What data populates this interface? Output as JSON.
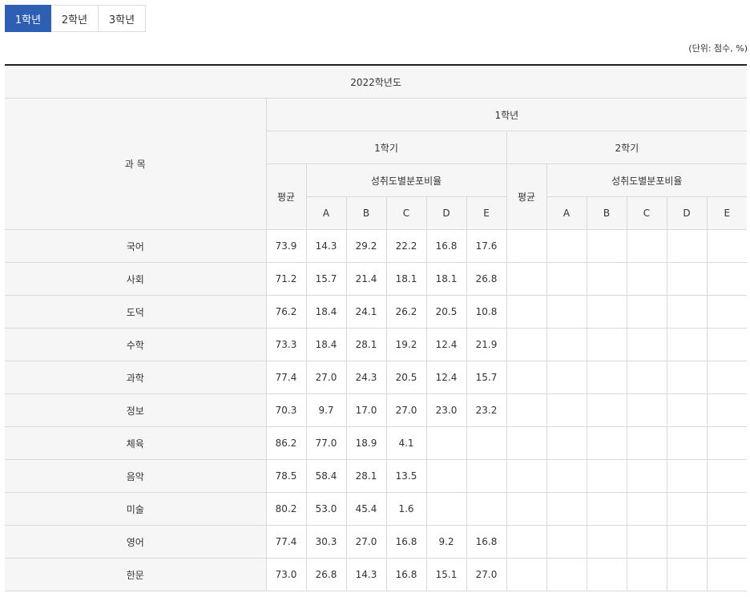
{
  "tabs": [
    "1학년",
    "2학년",
    "3학년"
  ],
  "unit_note": "(단위: 점수, %)",
  "table": {
    "school_year": "2022학년도",
    "subject_header": "과 목",
    "grade_header": "1학년",
    "semesters": [
      "1학기",
      "2학기"
    ],
    "avg_header": "평균",
    "dist_header": "성취도별분포비율",
    "levels": [
      "A",
      "B",
      "C",
      "D",
      "E"
    ],
    "rows": [
      {
        "subject": "국어",
        "s1": [
          "73.9",
          "14.3",
          "29.2",
          "22.2",
          "16.8",
          "17.6"
        ],
        "s2": [
          "",
          "",
          "",
          "",
          "",
          ""
        ]
      },
      {
        "subject": "사회",
        "s1": [
          "71.2",
          "15.7",
          "21.4",
          "18.1",
          "18.1",
          "26.8"
        ],
        "s2": [
          "",
          "",
          "",
          "",
          "",
          ""
        ]
      },
      {
        "subject": "도덕",
        "s1": [
          "76.2",
          "18.4",
          "24.1",
          "26.2",
          "20.5",
          "10.8"
        ],
        "s2": [
          "",
          "",
          "",
          "",
          "",
          ""
        ]
      },
      {
        "subject": "수학",
        "s1": [
          "73.3",
          "18.4",
          "28.1",
          "19.2",
          "12.4",
          "21.9"
        ],
        "s2": [
          "",
          "",
          "",
          "",
          "",
          ""
        ]
      },
      {
        "subject": "과학",
        "s1": [
          "77.4",
          "27.0",
          "24.3",
          "20.5",
          "12.4",
          "15.7"
        ],
        "s2": [
          "",
          "",
          "",
          "",
          "",
          ""
        ]
      },
      {
        "subject": "정보",
        "s1": [
          "70.3",
          "9.7",
          "17.0",
          "27.0",
          "23.0",
          "23.2"
        ],
        "s2": [
          "",
          "",
          "",
          "",
          "",
          ""
        ]
      },
      {
        "subject": "체육",
        "s1": [
          "86.2",
          "77.0",
          "18.9",
          "4.1",
          "",
          ""
        ],
        "s2": [
          "",
          "",
          "",
          "",
          "",
          ""
        ]
      },
      {
        "subject": "음악",
        "s1": [
          "78.5",
          "58.4",
          "28.1",
          "13.5",
          "",
          ""
        ],
        "s2": [
          "",
          "",
          "",
          "",
          "",
          ""
        ]
      },
      {
        "subject": "미술",
        "s1": [
          "80.2",
          "53.0",
          "45.4",
          "1.6",
          "",
          ""
        ],
        "s2": [
          "",
          "",
          "",
          "",
          "",
          ""
        ]
      },
      {
        "subject": "영어",
        "s1": [
          "77.4",
          "30.3",
          "27.0",
          "16.8",
          "9.2",
          "16.8"
        ],
        "s2": [
          "",
          "",
          "",
          "",
          "",
          ""
        ]
      },
      {
        "subject": "한문",
        "s1": [
          "73.0",
          "26.8",
          "14.3",
          "16.8",
          "15.1",
          "27.0"
        ],
        "s2": [
          "",
          "",
          "",
          "",
          "",
          ""
        ]
      }
    ]
  }
}
